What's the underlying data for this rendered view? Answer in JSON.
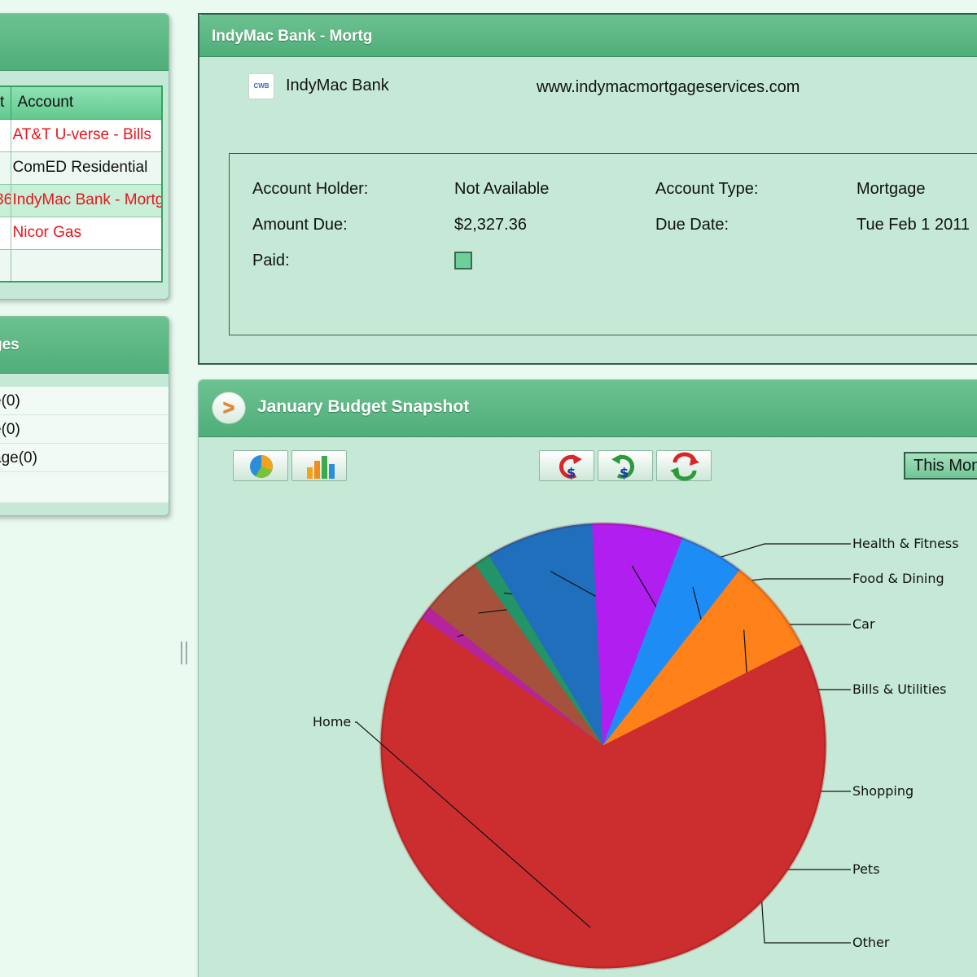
{
  "bills_panel": {
    "columns": [
      "t",
      "Account"
    ],
    "rows": [
      {
        "amount": "",
        "account": "AT&T U-verse - Bills",
        "color": "red"
      },
      {
        "amount": "",
        "account": "ComED Residential",
        "color": "black"
      },
      {
        "amount": "36",
        "account": "IndyMac Bank - Mortg",
        "color": "red"
      },
      {
        "amount": "",
        "account": "Nicor Gas",
        "color": "red"
      },
      {
        "amount": "",
        "account": "",
        "color": "black"
      }
    ]
  },
  "changes_panel": {
    "title": "ges",
    "items": [
      "e(0)",
      "e(0)",
      "age(0)"
    ]
  },
  "detail_panel": {
    "title": "IndyMac Bank - Mortg",
    "logo_text": "CWB",
    "bank_name": "IndyMac Bank",
    "url": "www.indymacmortgageservices.com",
    "account_holder_label": "Account Holder:",
    "account_holder_value": "Not Available",
    "account_type_label": "Account Type:",
    "account_type_value": "Mortgage",
    "amount_due_label": "Amount Due:",
    "amount_due_value": "$2,327.36",
    "due_date_label": "Due Date:",
    "due_date_value": "Tue Feb 1 2011",
    "paid_label": "Paid:"
  },
  "budget_panel": {
    "title": "January Budget Snapshot",
    "expand_icon": ">",
    "range_button": "This Month",
    "chart_toggle_icons": [
      "pie-chart-icon",
      "bar-chart-icon"
    ],
    "flow_icons": [
      "expense-icon",
      "income-icon",
      "net-icon"
    ]
  },
  "chart_data": {
    "type": "pie",
    "categories": [
      "Health & Fitness",
      "Food & Dining",
      "Car",
      "Bills & Utilities",
      "Shopping",
      "Pets",
      "Other",
      "Home"
    ],
    "values": [
      1.0,
      4.5,
      1.2,
      7.8,
      6.6,
      4.7,
      7.0,
      67.2
    ],
    "colors": [
      "#b5249a",
      "#a5513c",
      "#239368",
      "#1f6fbd",
      "#b01ff0",
      "#1e8cf5",
      "#ff8119",
      "#cc2e30"
    ],
    "start_angle_deg": 305,
    "direction": "clockwise"
  }
}
